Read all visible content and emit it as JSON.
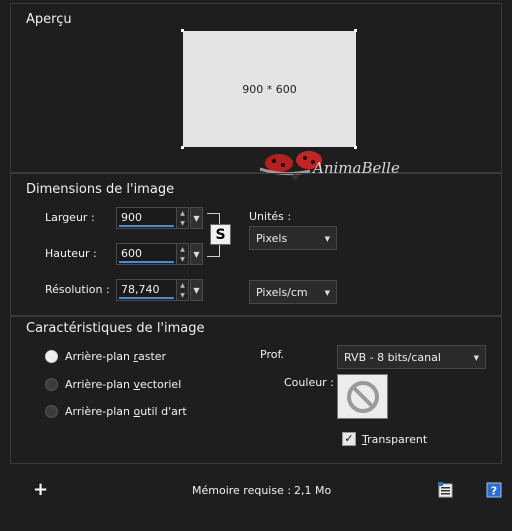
{
  "preview": {
    "title": "Aperçu",
    "size_text": "900 * 600",
    "watermark": "AnimaBelle"
  },
  "dimensions": {
    "title": "Dimensions de l'image",
    "width_label": "Largeur :",
    "width_value": "900",
    "height_label": "Hauteur :",
    "height_value": "600",
    "resolution_label": "Résolution :",
    "resolution_value": "78,740",
    "units_label": "Unités :",
    "units_value": "Pixels",
    "resolution_units_value": "Pixels/cm"
  },
  "characteristics": {
    "title": "Caractéristiques de l'image",
    "options": [
      {
        "label_pre": "Arrière-plan ",
        "label_u": "r",
        "label_post": "aster",
        "checked": true
      },
      {
        "label_pre": "Arrière-plan ",
        "label_u": "v",
        "label_post": "ectoriel",
        "checked": false
      },
      {
        "label_pre": "Arrière-plan ",
        "label_u": "o",
        "label_post": "util d'art",
        "checked": false
      }
    ],
    "depth_label": "Prof.",
    "depth_value": "RVB - 8 bits/canal",
    "color_label": "Couleur :",
    "transparent_u": "T",
    "transparent_post": "ransparent",
    "transparent_checked": true
  },
  "footer": {
    "memory_label": "Mémoire requise :",
    "memory_value": "2,1 Mo"
  },
  "icons": [
    "link-icon",
    "no-color-icon",
    "plus-icon",
    "preset-icon",
    "help-icon",
    "ladybug-icon"
  ],
  "colors": {
    "background": "#1e1e1e",
    "accent": "#3d8fd6",
    "preview_fill": "#e3e3e3"
  }
}
